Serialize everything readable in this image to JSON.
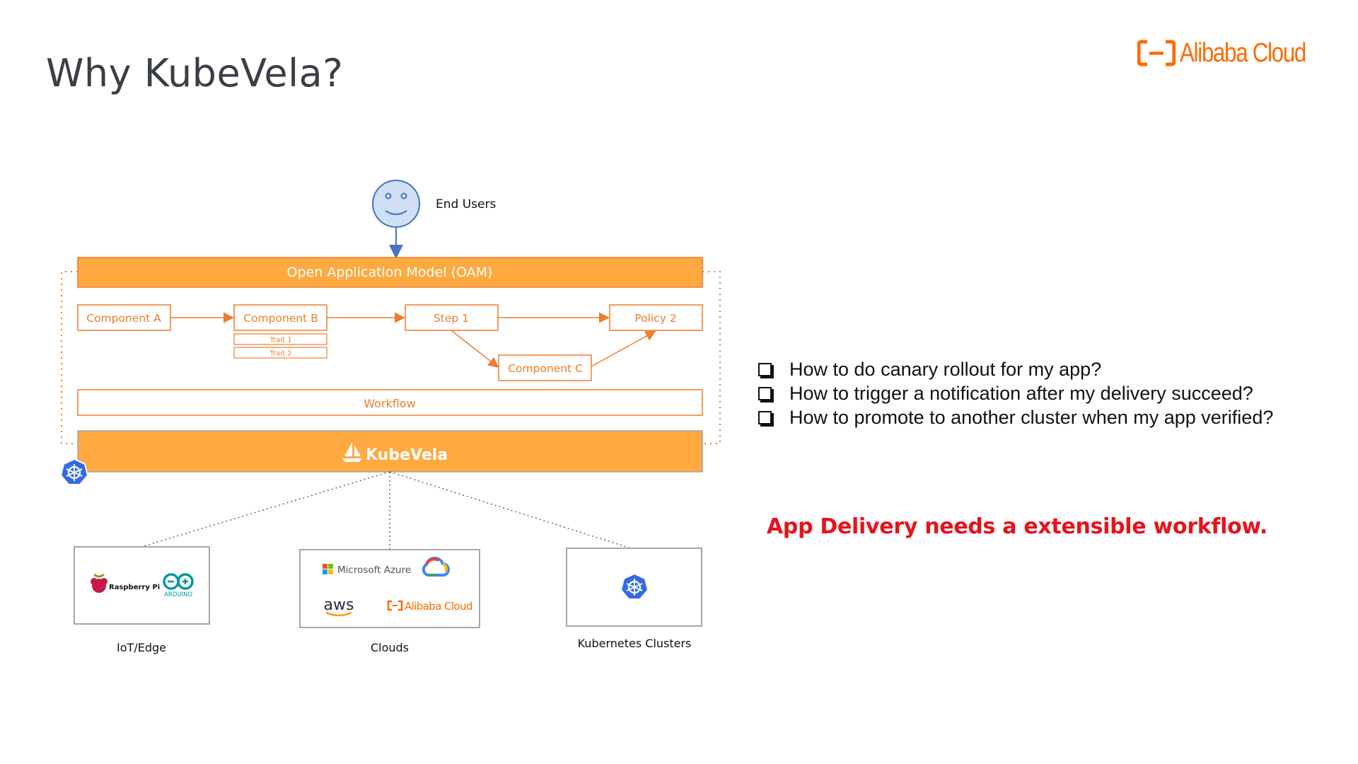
{
  "slide": {
    "title": "Why KubeVela?",
    "brand": "Alibaba Cloud"
  },
  "diagram": {
    "end_users_label": "End Users",
    "oam_label": "Open Application Model (OAM)",
    "component_a": "Component A",
    "component_b": "Component B",
    "trait_1": "Trait 1",
    "trait_2": "Trait 2",
    "step_1": "Step 1",
    "component_c": "Component C",
    "policy_2": "Policy 2",
    "workflow_label": "Workflow",
    "kubevela_label": "KubeVela",
    "targets": [
      {
        "label": "IoT/Edge",
        "logos": [
          "Raspberry Pi",
          "ARDUINO"
        ]
      },
      {
        "label": "Clouds",
        "logos": [
          "Microsoft Azure",
          "aws",
          "Alibaba Cloud"
        ]
      },
      {
        "label": "Kubernetes Clusters",
        "logos": []
      }
    ]
  },
  "questions": [
    "How to do canary rollout for my app?",
    "How to trigger a notification after my delivery succeed?",
    "How to promote to another cluster when my app verified?"
  ],
  "callout": "App Delivery needs a extensible workflow.",
  "colors": {
    "orange": "#ffa940",
    "orange_stroke": "#ed7d31",
    "k8s_blue": "#326ce5",
    "callout_red": "#e8121b"
  }
}
